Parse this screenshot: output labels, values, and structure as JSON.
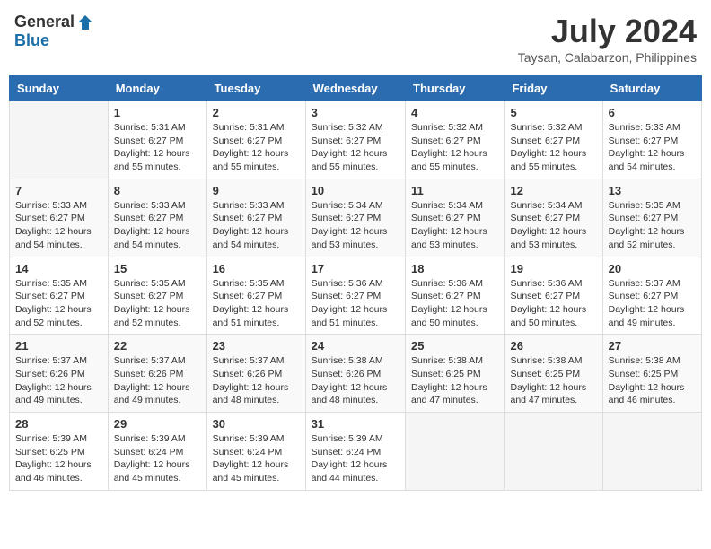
{
  "header": {
    "logo_general": "General",
    "logo_blue": "Blue",
    "month_year": "July 2024",
    "location": "Taysan, Calabarzon, Philippines"
  },
  "calendar": {
    "days_of_week": [
      "Sunday",
      "Monday",
      "Tuesday",
      "Wednesday",
      "Thursday",
      "Friday",
      "Saturday"
    ],
    "weeks": [
      [
        {
          "day": "",
          "info": ""
        },
        {
          "day": "1",
          "info": "Sunrise: 5:31 AM\nSunset: 6:27 PM\nDaylight: 12 hours\nand 55 minutes."
        },
        {
          "day": "2",
          "info": "Sunrise: 5:31 AM\nSunset: 6:27 PM\nDaylight: 12 hours\nand 55 minutes."
        },
        {
          "day": "3",
          "info": "Sunrise: 5:32 AM\nSunset: 6:27 PM\nDaylight: 12 hours\nand 55 minutes."
        },
        {
          "day": "4",
          "info": "Sunrise: 5:32 AM\nSunset: 6:27 PM\nDaylight: 12 hours\nand 55 minutes."
        },
        {
          "day": "5",
          "info": "Sunrise: 5:32 AM\nSunset: 6:27 PM\nDaylight: 12 hours\nand 55 minutes."
        },
        {
          "day": "6",
          "info": "Sunrise: 5:33 AM\nSunset: 6:27 PM\nDaylight: 12 hours\nand 54 minutes."
        }
      ],
      [
        {
          "day": "7",
          "info": "Sunrise: 5:33 AM\nSunset: 6:27 PM\nDaylight: 12 hours\nand 54 minutes."
        },
        {
          "day": "8",
          "info": "Sunrise: 5:33 AM\nSunset: 6:27 PM\nDaylight: 12 hours\nand 54 minutes."
        },
        {
          "day": "9",
          "info": "Sunrise: 5:33 AM\nSunset: 6:27 PM\nDaylight: 12 hours\nand 54 minutes."
        },
        {
          "day": "10",
          "info": "Sunrise: 5:34 AM\nSunset: 6:27 PM\nDaylight: 12 hours\nand 53 minutes."
        },
        {
          "day": "11",
          "info": "Sunrise: 5:34 AM\nSunset: 6:27 PM\nDaylight: 12 hours\nand 53 minutes."
        },
        {
          "day": "12",
          "info": "Sunrise: 5:34 AM\nSunset: 6:27 PM\nDaylight: 12 hours\nand 53 minutes."
        },
        {
          "day": "13",
          "info": "Sunrise: 5:35 AM\nSunset: 6:27 PM\nDaylight: 12 hours\nand 52 minutes."
        }
      ],
      [
        {
          "day": "14",
          "info": "Sunrise: 5:35 AM\nSunset: 6:27 PM\nDaylight: 12 hours\nand 52 minutes."
        },
        {
          "day": "15",
          "info": "Sunrise: 5:35 AM\nSunset: 6:27 PM\nDaylight: 12 hours\nand 52 minutes."
        },
        {
          "day": "16",
          "info": "Sunrise: 5:35 AM\nSunset: 6:27 PM\nDaylight: 12 hours\nand 51 minutes."
        },
        {
          "day": "17",
          "info": "Sunrise: 5:36 AM\nSunset: 6:27 PM\nDaylight: 12 hours\nand 51 minutes."
        },
        {
          "day": "18",
          "info": "Sunrise: 5:36 AM\nSunset: 6:27 PM\nDaylight: 12 hours\nand 50 minutes."
        },
        {
          "day": "19",
          "info": "Sunrise: 5:36 AM\nSunset: 6:27 PM\nDaylight: 12 hours\nand 50 minutes."
        },
        {
          "day": "20",
          "info": "Sunrise: 5:37 AM\nSunset: 6:27 PM\nDaylight: 12 hours\nand 49 minutes."
        }
      ],
      [
        {
          "day": "21",
          "info": "Sunrise: 5:37 AM\nSunset: 6:26 PM\nDaylight: 12 hours\nand 49 minutes."
        },
        {
          "day": "22",
          "info": "Sunrise: 5:37 AM\nSunset: 6:26 PM\nDaylight: 12 hours\nand 49 minutes."
        },
        {
          "day": "23",
          "info": "Sunrise: 5:37 AM\nSunset: 6:26 PM\nDaylight: 12 hours\nand 48 minutes."
        },
        {
          "day": "24",
          "info": "Sunrise: 5:38 AM\nSunset: 6:26 PM\nDaylight: 12 hours\nand 48 minutes."
        },
        {
          "day": "25",
          "info": "Sunrise: 5:38 AM\nSunset: 6:25 PM\nDaylight: 12 hours\nand 47 minutes."
        },
        {
          "day": "26",
          "info": "Sunrise: 5:38 AM\nSunset: 6:25 PM\nDaylight: 12 hours\nand 47 minutes."
        },
        {
          "day": "27",
          "info": "Sunrise: 5:38 AM\nSunset: 6:25 PM\nDaylight: 12 hours\nand 46 minutes."
        }
      ],
      [
        {
          "day": "28",
          "info": "Sunrise: 5:39 AM\nSunset: 6:25 PM\nDaylight: 12 hours\nand 46 minutes."
        },
        {
          "day": "29",
          "info": "Sunrise: 5:39 AM\nSunset: 6:24 PM\nDaylight: 12 hours\nand 45 minutes."
        },
        {
          "day": "30",
          "info": "Sunrise: 5:39 AM\nSunset: 6:24 PM\nDaylight: 12 hours\nand 45 minutes."
        },
        {
          "day": "31",
          "info": "Sunrise: 5:39 AM\nSunset: 6:24 PM\nDaylight: 12 hours\nand 44 minutes."
        },
        {
          "day": "",
          "info": ""
        },
        {
          "day": "",
          "info": ""
        },
        {
          "day": "",
          "info": ""
        }
      ]
    ]
  }
}
